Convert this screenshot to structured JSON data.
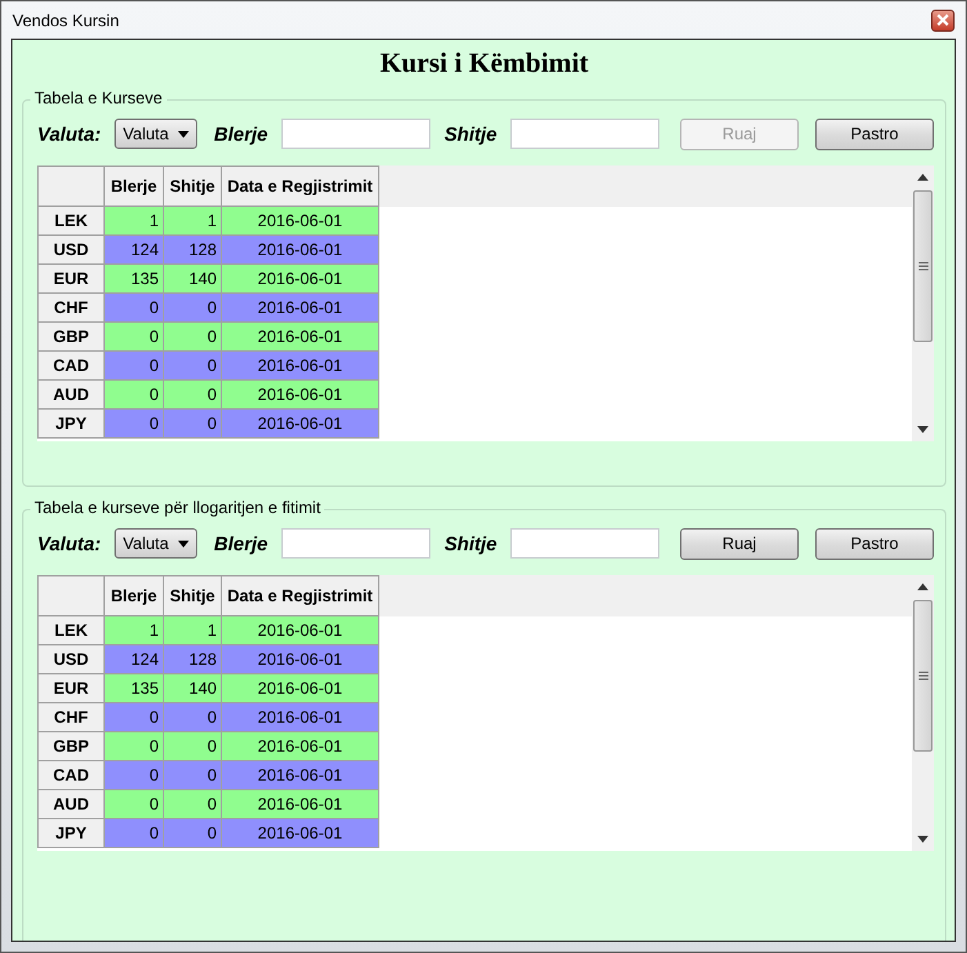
{
  "window": {
    "title": "Vendos Kursin"
  },
  "heading": "Kursi i Këmbimit",
  "sections": [
    {
      "title": "Tabela e Kurseve",
      "currency_label": "Valuta:",
      "currency_select": "Valuta",
      "buy_label": "Blerje",
      "sell_label": "Shitje",
      "buttons": [
        {
          "label": "Ruaj",
          "disabled": true
        },
        {
          "label": "Pastro",
          "disabled": false
        }
      ],
      "table": {
        "columns": [
          "Blerje",
          "Shitje",
          "Data e Regjistrimit"
        ],
        "rows": [
          {
            "code": "LEK",
            "buy": "1",
            "sell": "1",
            "date": "2016-06-01",
            "color": "#90fd8f"
          },
          {
            "code": "USD",
            "buy": "124",
            "sell": "128",
            "date": "2016-06-01",
            "color": "#8f8ffd"
          },
          {
            "code": "EUR",
            "buy": "135",
            "sell": "140",
            "date": "2016-06-01",
            "color": "#90fd8f"
          },
          {
            "code": "CHF",
            "buy": "0",
            "sell": "0",
            "date": "2016-06-01",
            "color": "#8f8ffd"
          },
          {
            "code": "GBP",
            "buy": "0",
            "sell": "0",
            "date": "2016-06-01",
            "color": "#90fd8f"
          },
          {
            "code": "CAD",
            "buy": "0",
            "sell": "0",
            "date": "2016-06-01",
            "color": "#8f8ffd"
          },
          {
            "code": "AUD",
            "buy": "0",
            "sell": "0",
            "date": "2016-06-01",
            "color": "#90fd8f"
          },
          {
            "code": "JPY",
            "buy": "0",
            "sell": "0",
            "date": "2016-06-01",
            "color": "#8f8ffd"
          }
        ]
      }
    },
    {
      "title": "Tabela e kurseve për llogaritjen e fitimit",
      "currency_label": "Valuta:",
      "currency_select": "Valuta",
      "buy_label": "Blerje",
      "sell_label": "Shitje",
      "buttons": [
        {
          "label": "Ruaj",
          "disabled": false
        },
        {
          "label": "Pastro",
          "disabled": false
        }
      ],
      "table": {
        "columns": [
          "Blerje",
          "Shitje",
          "Data e Regjistrimit"
        ],
        "rows": [
          {
            "code": "LEK",
            "buy": "1",
            "sell": "1",
            "date": "2016-06-01",
            "color": "#90fd8f"
          },
          {
            "code": "USD",
            "buy": "124",
            "sell": "128",
            "date": "2016-06-01",
            "color": "#8f8ffd"
          },
          {
            "code": "EUR",
            "buy": "135",
            "sell": "140",
            "date": "2016-06-01",
            "color": "#90fd8f"
          },
          {
            "code": "CHF",
            "buy": "0",
            "sell": "0",
            "date": "2016-06-01",
            "color": "#8f8ffd"
          },
          {
            "code": "GBP",
            "buy": "0",
            "sell": "0",
            "date": "2016-06-01",
            "color": "#90fd8f"
          },
          {
            "code": "CAD",
            "buy": "0",
            "sell": "0",
            "date": "2016-06-01",
            "color": "#8f8ffd"
          },
          {
            "code": "AUD",
            "buy": "0",
            "sell": "0",
            "date": "2016-06-01",
            "color": "#90fd8f"
          },
          {
            "code": "JPY",
            "buy": "0",
            "sell": "0",
            "date": "2016-06-01",
            "color": "#8f8ffd"
          }
        ]
      }
    }
  ]
}
